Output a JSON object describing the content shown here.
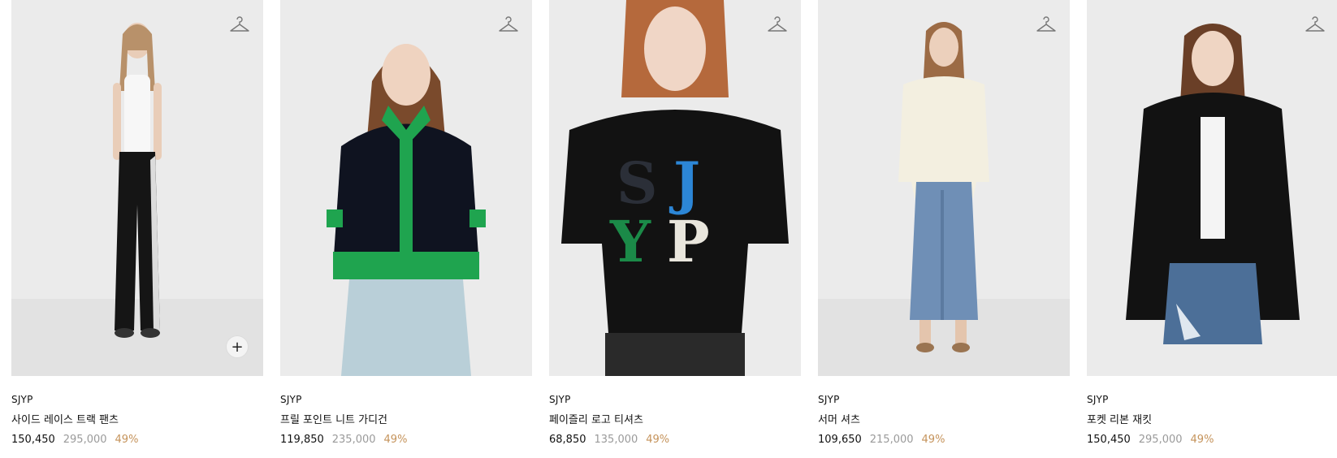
{
  "products": [
    {
      "brand": "SJYP",
      "name": "사이드 레이스 트랙 팬츠",
      "sale_price": "150,450",
      "original_price": "295,000",
      "discount": "49%",
      "has_quick_add": true
    },
    {
      "brand": "SJYP",
      "name": "프릴 포인트 니트 가디건",
      "sale_price": "119,850",
      "original_price": "235,000",
      "discount": "49%",
      "has_quick_add": false
    },
    {
      "brand": "SJYP",
      "name": "페이즐리 로고 티셔츠",
      "sale_price": "68,850",
      "original_price": "135,000",
      "discount": "49%",
      "has_quick_add": false
    },
    {
      "brand": "SJYP",
      "name": "서머 셔츠",
      "sale_price": "109,650",
      "original_price": "215,000",
      "discount": "49%",
      "has_quick_add": false
    },
    {
      "brand": "SJYP",
      "name": "포켓 리본 재킷",
      "sale_price": "150,450",
      "original_price": "295,000",
      "discount": "49%",
      "has_quick_add": false
    }
  ],
  "icons": {
    "wishlist": "hanger-icon",
    "quick_add": "plus-icon"
  },
  "colors": {
    "discount": "#c5935b",
    "original_price": "#9a9a9a",
    "image_bg": "#ebebeb"
  },
  "quick_add_symbol": "+"
}
